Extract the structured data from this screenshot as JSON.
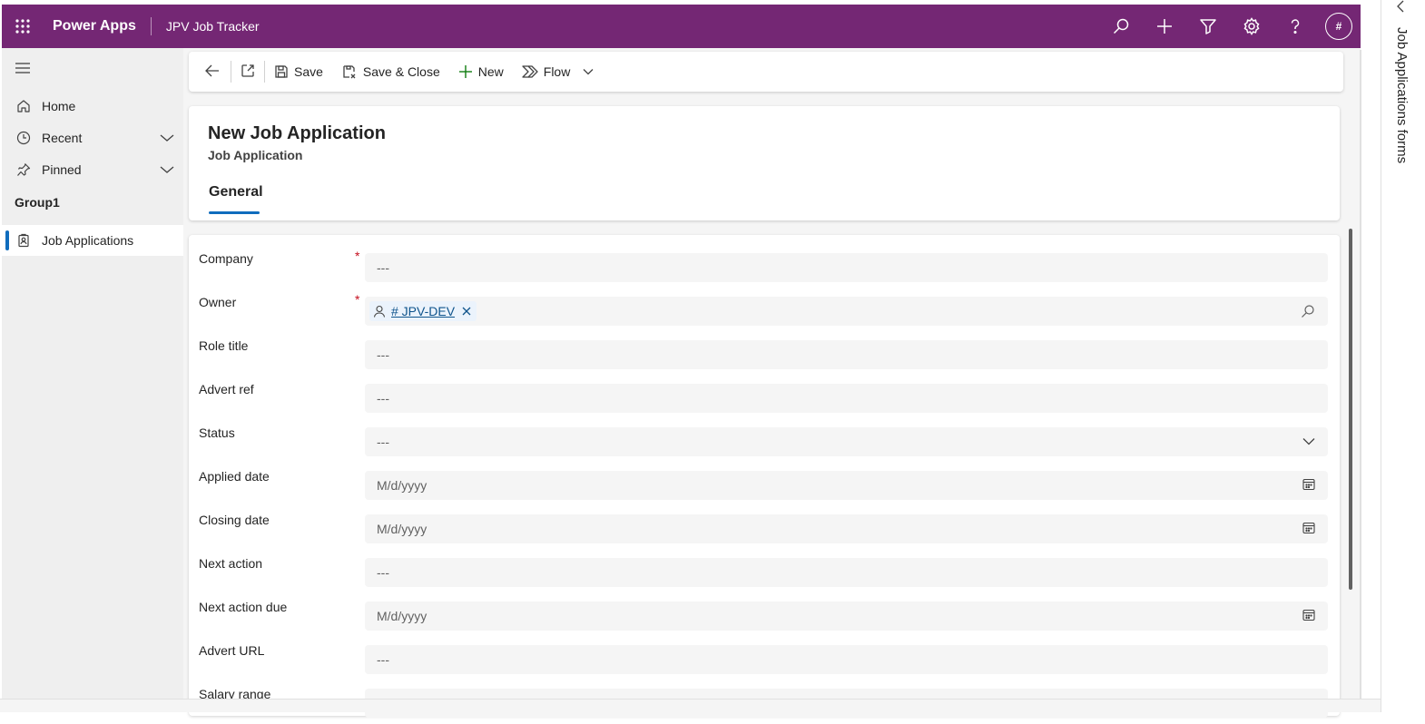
{
  "topbar": {
    "app_name": "Power Apps",
    "env_name": "JPV Job Tracker",
    "avatar_initials": "#",
    "icons": [
      "search-icon",
      "add-icon",
      "filter-icon",
      "settings-icon",
      "help-icon"
    ]
  },
  "sidenav": {
    "items": [
      {
        "label": "Home",
        "icon": "home-icon"
      },
      {
        "label": "Recent",
        "icon": "clock-icon"
      },
      {
        "label": "Pinned",
        "icon": "pin-icon"
      }
    ],
    "group_title": "Group1",
    "group_items": [
      {
        "label": "Job Applications",
        "icon": "entity-icon",
        "selected": true
      }
    ]
  },
  "commandbar": {
    "save": "Save",
    "save_close": "Save & Close",
    "new": "New",
    "flow": "Flow"
  },
  "form": {
    "title": "New Job Application",
    "subtitle": "Job Application",
    "tab_general": "General",
    "fields": [
      {
        "label": "Company",
        "value": "---",
        "required": true
      },
      {
        "label": "Owner",
        "value": "# JPV-DEV",
        "required": true
      },
      {
        "label": "Role title",
        "value": "---"
      },
      {
        "label": "Advert ref",
        "value": "---"
      },
      {
        "label": "Status",
        "value": "---"
      },
      {
        "label": "Applied date",
        "value": "M/d/yyyy"
      },
      {
        "label": "Closing date",
        "value": "M/d/yyyy"
      },
      {
        "label": "Next action",
        "value": "---"
      },
      {
        "label": "Next action due",
        "value": "M/d/yyyy"
      },
      {
        "label": "Advert URL",
        "value": "---"
      },
      {
        "label": "Salary range",
        "value": ""
      }
    ]
  },
  "right_pane": {
    "label": "Job Applications forms"
  },
  "colors": {
    "brand": "#742774",
    "accent": "#0f6cbd",
    "required": "#c50f1f"
  }
}
